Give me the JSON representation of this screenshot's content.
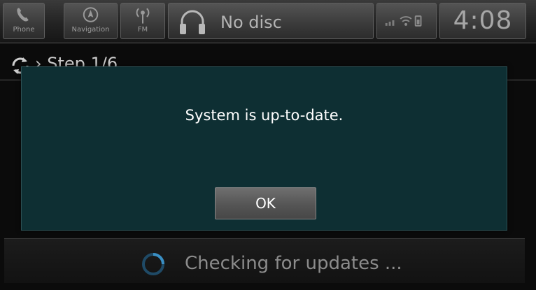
{
  "topbar": {
    "phone": {
      "label": "Phone",
      "icon": "phone-icon"
    },
    "navigation": {
      "label": "Navigation",
      "icon": "navigation-icon"
    },
    "fm": {
      "label": "FM",
      "icon": "radio-antenna-icon"
    },
    "audio": {
      "source_text": "No disc",
      "icon": "headphones-icon"
    },
    "status_icons": [
      "signal-bars-icon",
      "wifi-icon",
      "phone-battery-icon"
    ],
    "clock": "4:08"
  },
  "page": {
    "step_label": "Step 1/6",
    "status_text": "Checking for updates ..."
  },
  "dialog": {
    "message": "System is up-to-date.",
    "ok_label": "OK"
  },
  "colors": {
    "dialog_background": "#0e2f33",
    "button_gray": "#5a5a5a",
    "spinner_blue": "#3a8fc4"
  }
}
